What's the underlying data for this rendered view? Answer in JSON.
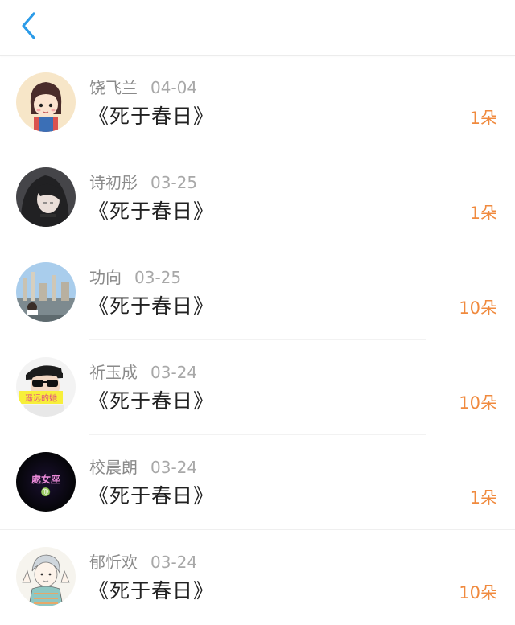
{
  "colors": {
    "accent_back": "#2b9be8",
    "amount": "#f08a3e",
    "name": "#8a8a8a",
    "date": "#a8a8a8",
    "title": "#222222"
  },
  "header": {
    "back_icon": "chevron-left-icon"
  },
  "records": [
    {
      "name": "饶飞兰",
      "date": "04-04",
      "title": "《死于春日》",
      "amount": "1朵",
      "avatar": "cartoon-girl-avatar"
    },
    {
      "name": "诗初彤",
      "date": "03-25",
      "title": "《死于春日》",
      "amount": "1朵",
      "avatar": "dark-hair-girl-avatar"
    },
    {
      "name": "功向",
      "date": "03-25",
      "title": "《死于春日》",
      "amount": "10朵",
      "avatar": "cityscape-avatar"
    },
    {
      "name": "祈玉成",
      "date": "03-24",
      "title": "《死于春日》",
      "amount": "10朵",
      "avatar": "sunglasses-avatar",
      "avatar_caption": "遥远的她"
    },
    {
      "name": "校晨朗",
      "date": "03-24",
      "title": "《死于春日》",
      "amount": "1朵",
      "avatar": "neon-text-avatar",
      "avatar_caption": "處女座"
    },
    {
      "name": "郁忻欢",
      "date": "03-24",
      "title": "《死于春日》",
      "amount": "10朵",
      "avatar": "sketch-boy-avatar"
    }
  ]
}
